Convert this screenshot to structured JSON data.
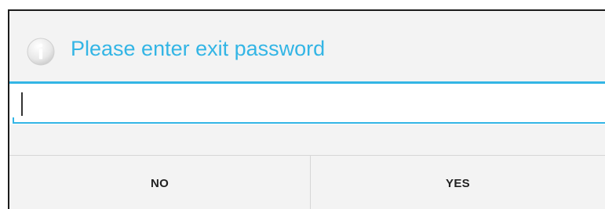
{
  "dialog": {
    "title": "Please enter exit password",
    "icon": "info-icon",
    "accent_color": "#33b5e5"
  },
  "password": {
    "value": "",
    "placeholder": ""
  },
  "buttons": {
    "no_label": "NO",
    "yes_label": "YES"
  }
}
